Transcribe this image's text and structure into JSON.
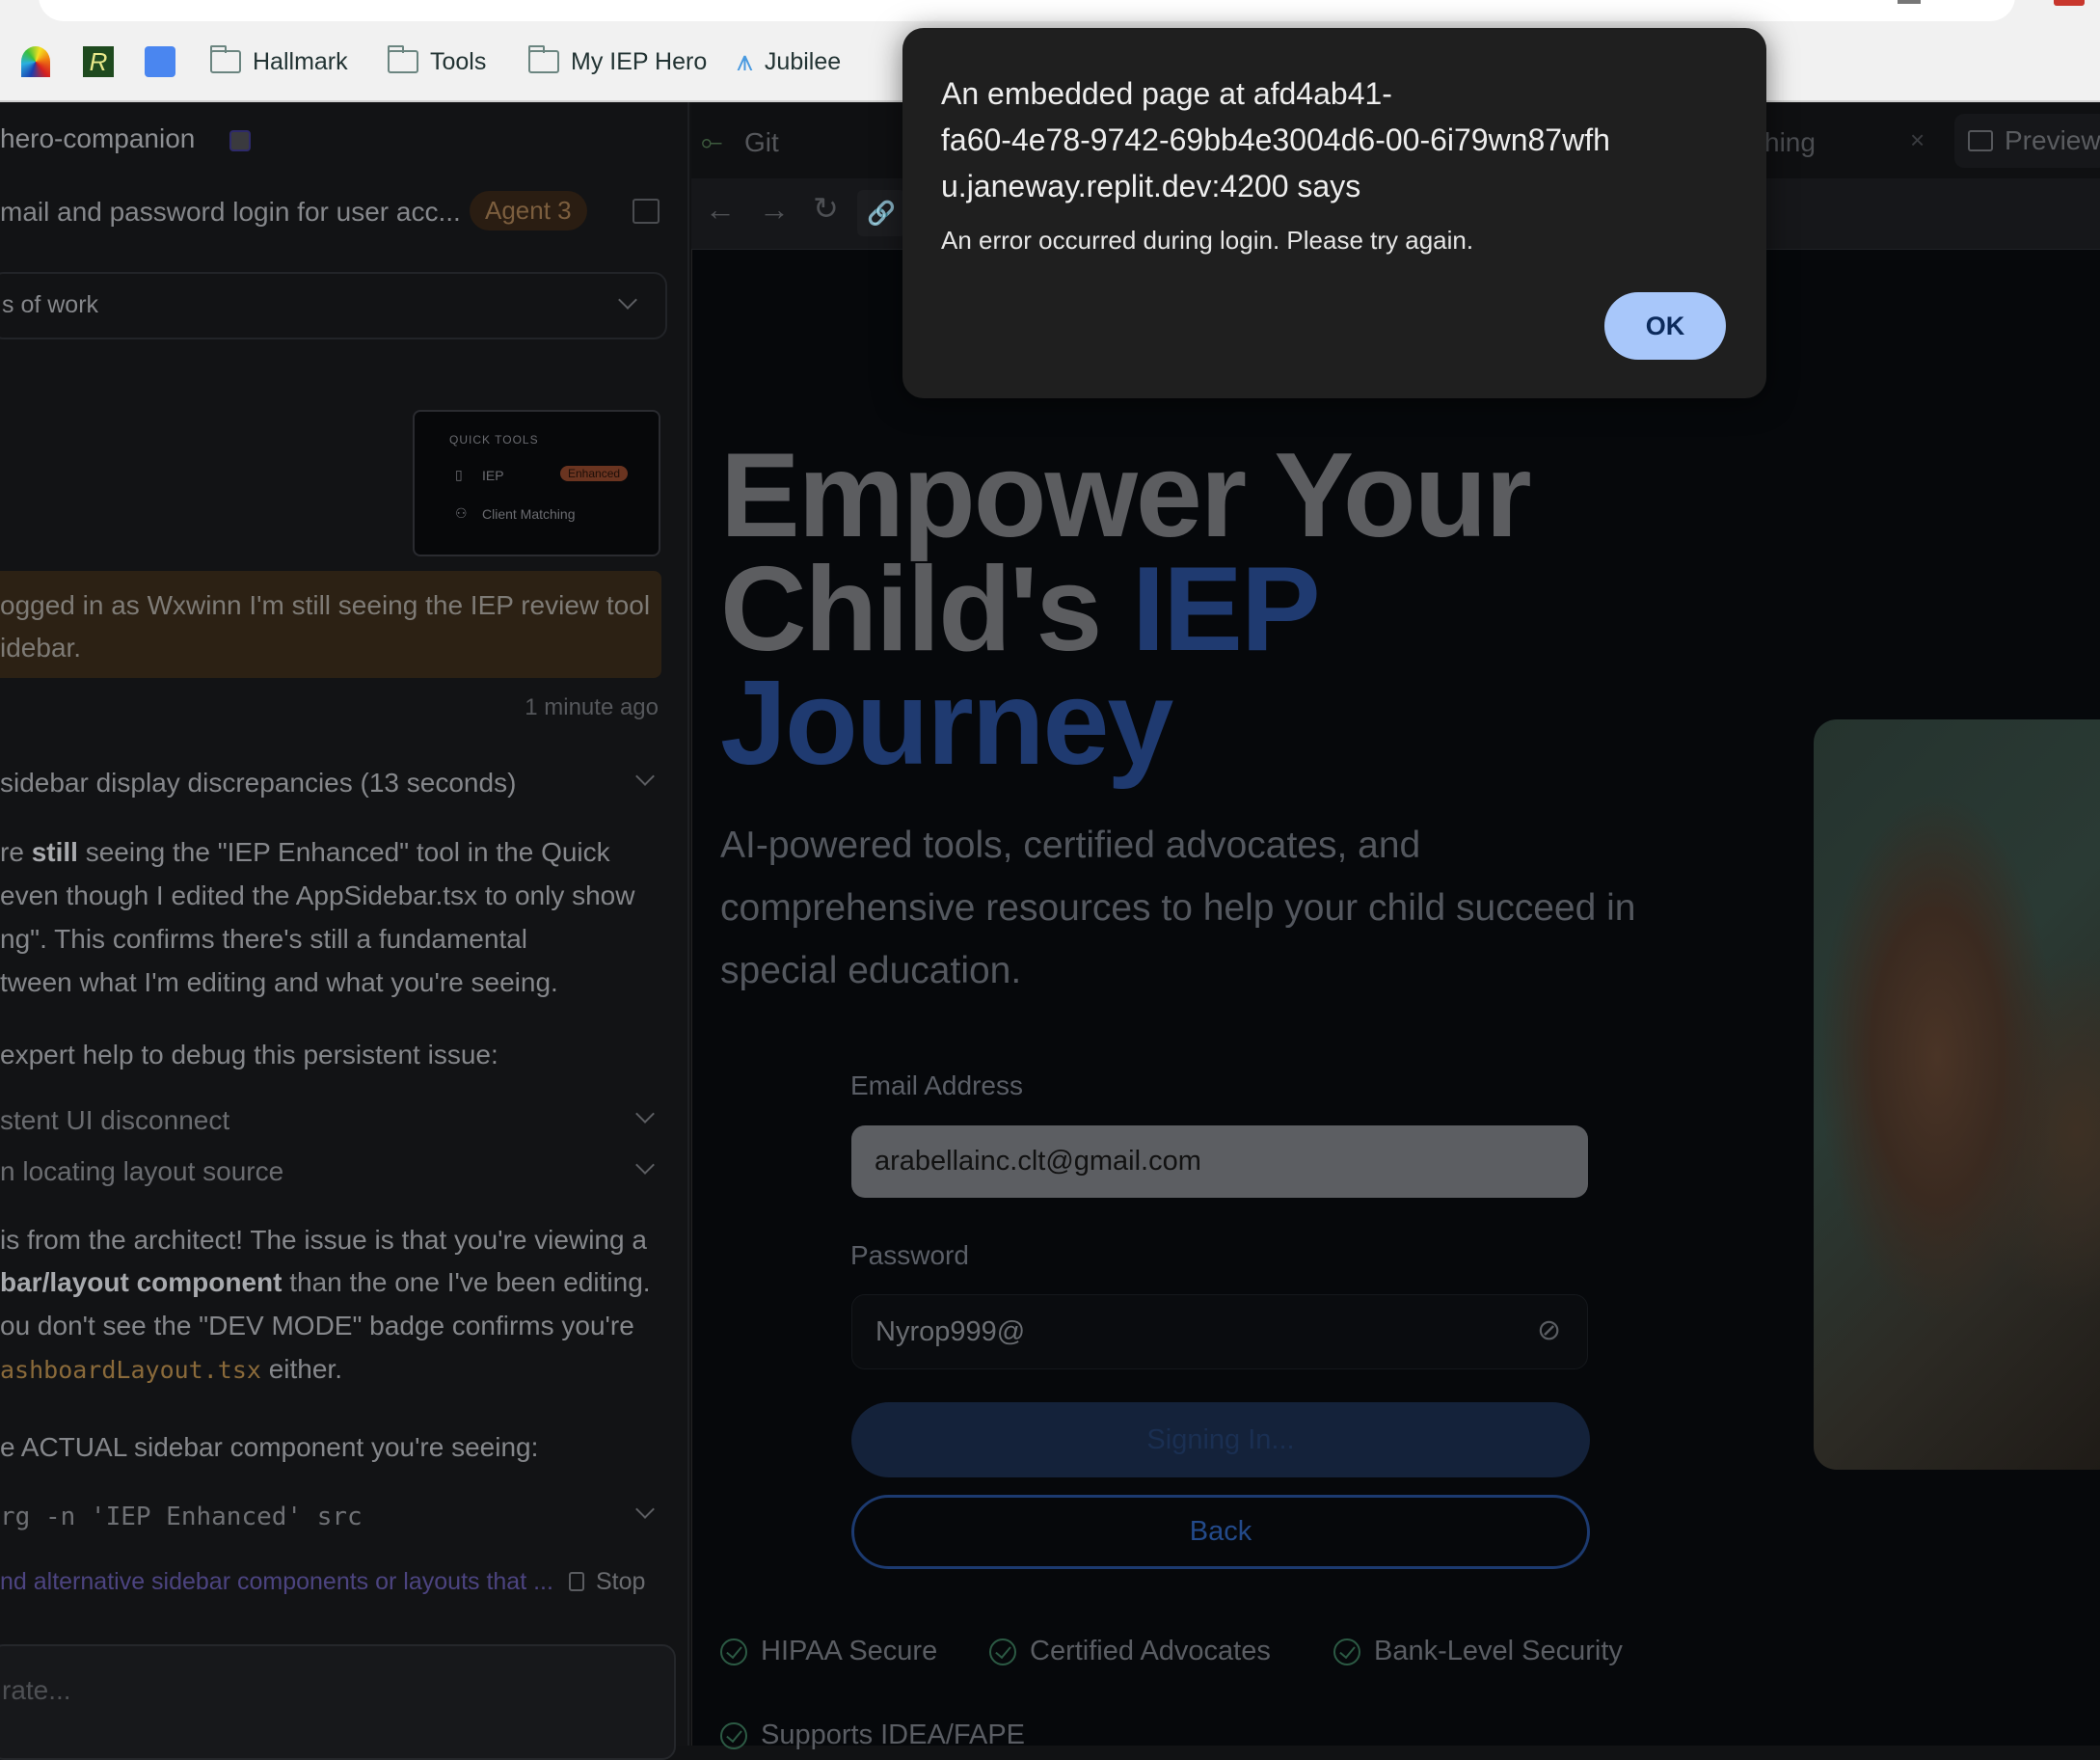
{
  "bookmarks": [
    {
      "label": "Hallmark"
    },
    {
      "label": "Tools"
    },
    {
      "label": "My IEP Hero"
    },
    {
      "label": "Jubilee"
    }
  ],
  "left": {
    "project": "hero-companion",
    "task_title": "mail and password login for user acc...",
    "agent_badge": "Agent 3",
    "dropdown": "s of work",
    "quick_tools": {
      "heading": "QUICK TOOLS",
      "item1": "IEP",
      "badge": "Enhanced",
      "item2": "Client Matching"
    },
    "user_msg": [
      "ogged in as Wxwinn I'm still seeing the IEP review tool",
      "idebar."
    ],
    "timestamp": "1 minute ago",
    "thought": "sidebar display discrepancies (13 seconds)",
    "p1_pre": "re ",
    "p1_bold": "still",
    "p1_post": " seeing the \"IEP Enhanced\" tool in the Quick",
    "p1": [
      "even though I edited the AppSidebar.tsx to only show",
      "ng\". This confirms there's still a fundamental",
      "tween what I'm editing and what you're seeing."
    ],
    "p2": "expert help to debug this persistent issue:",
    "collapse1": "stent UI disconnect",
    "collapse2": "n locating layout source",
    "p3_l1": "is from the architect! The issue is that you're viewing a",
    "p3_l2_bold": "bar/layout component",
    "p3_l2": " than the one I've been editing.",
    "p3_l3": "ou don't see the \"DEV MODE\" badge confirms you're",
    "p3_l4_code": "ashboardLayout.tsx",
    "p3_l4": " either.",
    "p4": "e ACTUAL sidebar component you're seeing:",
    "code": "rg -n 'IEP Enhanced' src",
    "action_link": "nd alternative sidebar components or layouts that ...",
    "stop": "Stop",
    "input_placeholder": "rate..."
  },
  "right": {
    "git_tab": "Git",
    "tab_partial": "hing",
    "preview": "Preview",
    "hero_l1": "Empower Your",
    "hero_l2a": "Child's ",
    "hero_l2b": "IEP",
    "hero_l3": "Journey",
    "subtitle": [
      "AI-powered tools, certified advocates, and",
      "comprehensive resources to help your child succeed in",
      "special education."
    ],
    "email_label": "Email Address",
    "email_value": "arabellainc.clt@gmail.com",
    "password_label": "Password",
    "password_value": "Nyrop999@",
    "signing_in": "Signing In...",
    "back": "Back",
    "badges": [
      "HIPAA Secure",
      "Certified Advocates",
      "Bank-Level Security",
      "Supports IDEA/FAPE"
    ]
  },
  "dialog": {
    "title": [
      "An embedded page at afd4ab41-",
      "fa60-4e78-9742-69bb4e3004d6-00-6i79wn87wfh",
      "u.janeway.replit.dev:4200 says"
    ],
    "message": "An error occurred during login. Please try again.",
    "ok": "OK"
  }
}
